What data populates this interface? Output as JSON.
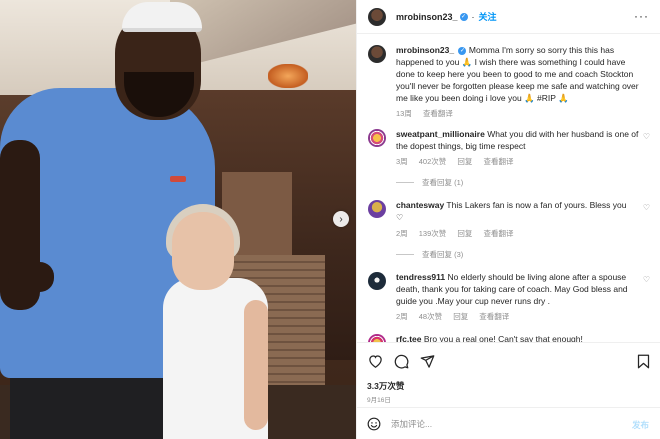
{
  "post": {
    "username": "mrobinson23_",
    "follow_label": "关注",
    "more_icon": "more-horizontal-icon"
  },
  "caption": {
    "username": "mrobinson23_",
    "text": "Momma I'm sorry so sorry this this has happened to you 🙏 I wish there was something I could have done to keep here you been to good to me and coach Stockton you'll never be forgotten please keep me safe and watching over me like you been doing i love you 🙏 #RIP 🙏",
    "time": "13周",
    "see_translation": "查看翻译"
  },
  "comments": [
    {
      "username": "sweatpant_millionaire",
      "text": "What you did with her husband is one of the dopest things, big time respect",
      "time": "3周",
      "likes": "402次赞",
      "reply": "回复",
      "see_translation": "查看翻译",
      "view_replies": "查看回复 (1)"
    },
    {
      "username": "chantesway",
      "text": "This Lakers fan is now a fan of yours. Bless you",
      "text_suffix": "♡",
      "time": "2周",
      "likes": "139次赞",
      "reply": "回复",
      "see_translation": "查看翻译",
      "view_replies": "查看回复 (3)"
    },
    {
      "username": "tendress911",
      "text": "No elderly should be living alone after a spouse death, thank you for taking care of coach. May God bless and guide you .May your cup never runs dry .",
      "time": "2周",
      "likes": "48次赞",
      "reply": "回复",
      "see_translation": "查看翻译"
    },
    {
      "username": "rfc.tee",
      "text": "Bro you a real one! Can't say that enough!"
    }
  ],
  "actions": {
    "likes": "3.3万次赞",
    "date": "9月16日",
    "comment_placeholder": "添加评论...",
    "post_label": "发布"
  }
}
